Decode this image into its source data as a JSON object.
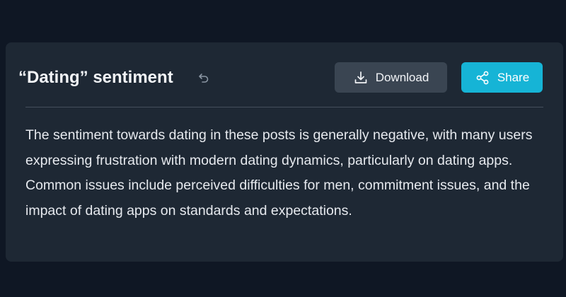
{
  "card": {
    "title": "“Dating” sentiment",
    "actions": {
      "download_label": "Download",
      "share_label": "Share"
    },
    "icons": {
      "undo": "undo-icon",
      "download": "download-icon",
      "share": "share-icon"
    },
    "summary": "The sentiment towards dating in these posts is generally negative, with many users expressing frustration with modern dating dynamics, particularly on dating apps. Common issues include perceived difficulties for men, commitment issues, and the impact of dating apps on standards and expectations."
  },
  "colors": {
    "page_background": "#0f1724",
    "card_background": "#1e2834",
    "download_button": "#3a4552",
    "share_button": "#16b4d6"
  }
}
